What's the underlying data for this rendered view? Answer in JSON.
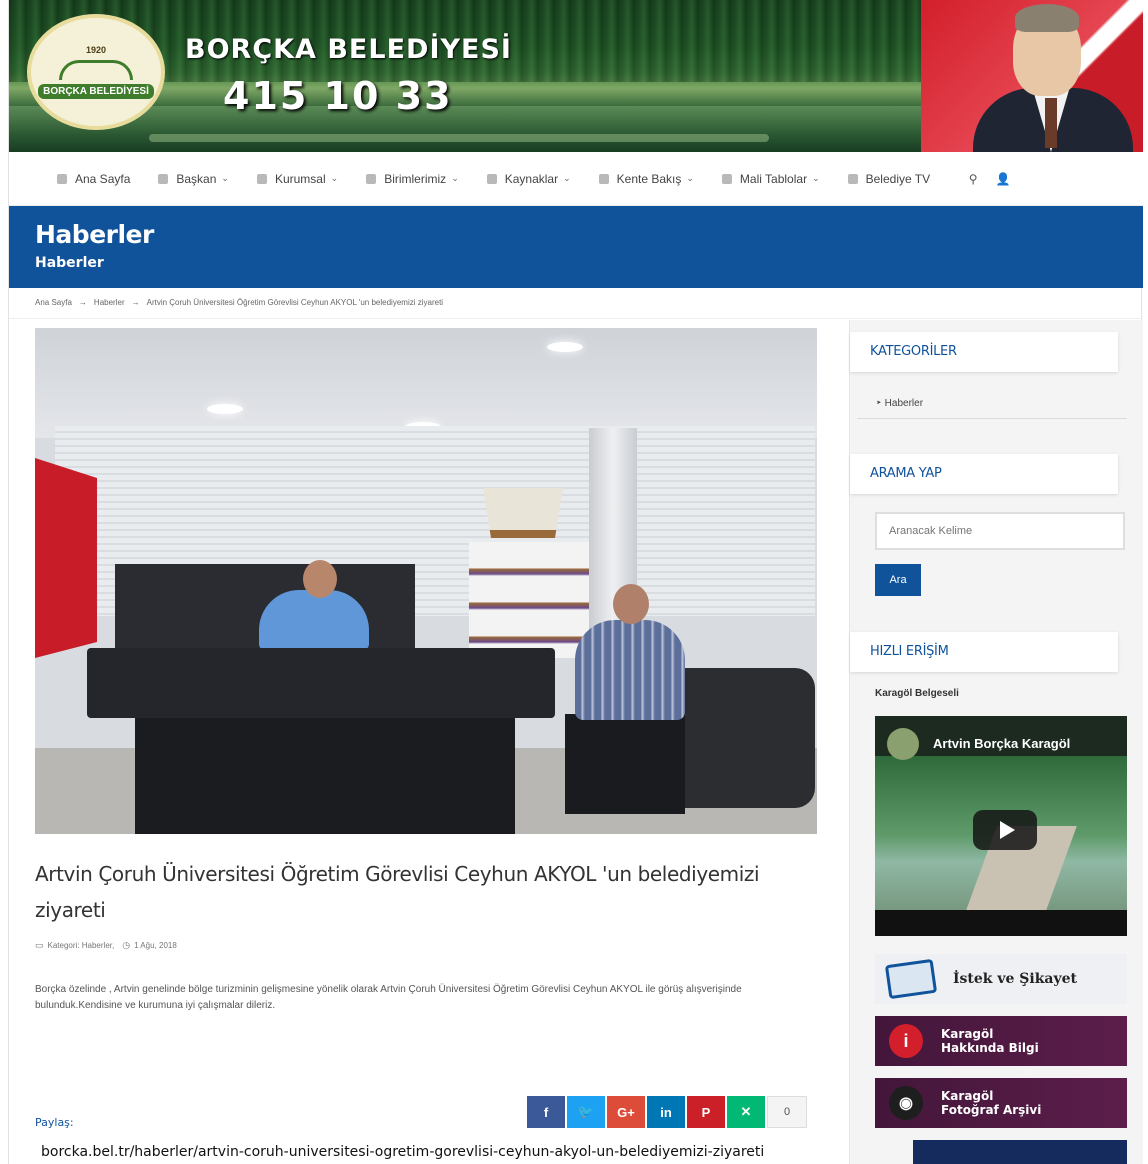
{
  "header": {
    "logo_top": "1920",
    "logo_name": "BORÇKA BELEDİYESİ",
    "title": "BORÇKA BELEDİYESİ",
    "phone": "415 10 33"
  },
  "nav": {
    "items": [
      {
        "label": "Ana Sayfa",
        "icon": "home-icon",
        "dropdown": false
      },
      {
        "label": "Başkan",
        "icon": "user-card-icon",
        "dropdown": true
      },
      {
        "label": "Kurumsal",
        "icon": "building-icon",
        "dropdown": true
      },
      {
        "label": "Birimlerimiz",
        "icon": "gear-icon",
        "dropdown": true
      },
      {
        "label": "Kaynaklar",
        "icon": "book-icon",
        "dropdown": true
      },
      {
        "label": "Kente Bakış",
        "icon": "map-pin-icon",
        "dropdown": true
      },
      {
        "label": "Mali Tablolar",
        "icon": "money-icon",
        "dropdown": true
      },
      {
        "label": "Belediye TV",
        "icon": "tv-icon",
        "dropdown": false
      }
    ],
    "chevron": "⌄",
    "search_glyph": "⚲",
    "user_glyph": "👤"
  },
  "title_bar": {
    "title": "Haberler",
    "subtitle": "Haberler"
  },
  "breadcrumb": {
    "items": [
      "Ana Sayfa",
      "Haberler",
      "Artvin Çoruh Üniversitesi Öğretim Görevlisi Ceyhun AKYOL 'un belediyemizi ziyareti"
    ],
    "separator": "→"
  },
  "article": {
    "title": "Artvin Çoruh Üniversitesi Öğretim Görevlisi Ceyhun AKYOL 'un belediyemizi ziyareti",
    "category_label": "Kategori: Haberler,",
    "date": "1 Ağu, 2018",
    "body": "Borçka özelinde , Artvin genelinde bölge turizminin gelişmesine yönelik olarak Artvin Çoruh Üniversitesi Öğretim Görevlisi Ceyhun AKYOL ile görüş alışverişinde bulunduk.Kendisine ve kurumuna iyi çalışmalar dileriz.",
    "share_label": "Paylaş:",
    "share_buttons": [
      {
        "glyph": "f",
        "color": "#3b5998",
        "name": "facebook"
      },
      {
        "glyph": "🐦",
        "color": "#1da1f2",
        "name": "twitter"
      },
      {
        "glyph": "G+",
        "color": "#dd4b39",
        "name": "google-plus"
      },
      {
        "glyph": "in",
        "color": "#0077b5",
        "name": "linkedin"
      },
      {
        "glyph": "P",
        "color": "#cb2027",
        "name": "pinterest"
      },
      {
        "glyph": "✕",
        "color": "#02b875",
        "name": "xing"
      }
    ],
    "share_count": "0"
  },
  "sidebar": {
    "categories_title": "KATEGORİLER",
    "category_item": "‣ Haberler",
    "search_title": "ARAMA YAP",
    "search_placeholder": "Aranacak Kelime",
    "search_button": "Ara",
    "quick_title": "HIZLI ERİŞİM",
    "quick_label": "Karagöl Belgeseli",
    "video_title": "Artvin Borçka Karagöl",
    "complaint_label": "İstek ve Şikayet",
    "promo1_line1": "Karagöl",
    "promo1_line2": "Hakkında Bilgi",
    "promo1_glyph": "i",
    "promo2_line1": "Karagöl",
    "promo2_line2": "Fotoğraf Arşivi",
    "promo2_glyph": "◉"
  },
  "status_url": "borcka.bel.tr/haberler/artvin-coruh-universitesi-ogretim-gorevlisi-ceyhun-akyol-un-belediyemizi-ziyareti",
  "colors": {
    "primary_blue": "#10539b",
    "promo_purple": "#5c1e4b"
  }
}
